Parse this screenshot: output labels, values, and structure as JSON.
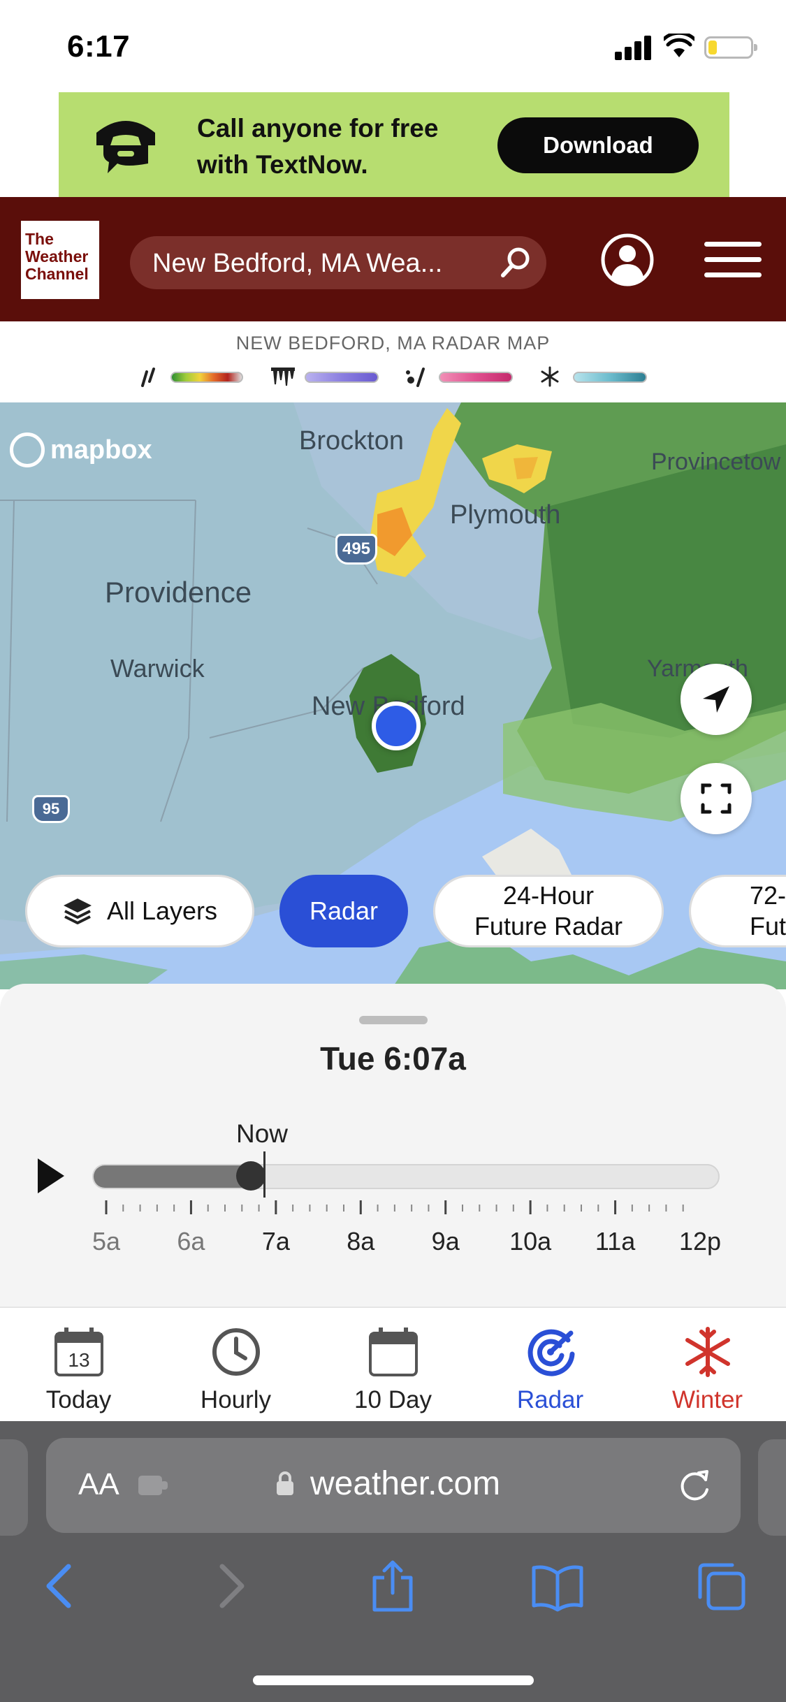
{
  "status_bar": {
    "time": "6:17"
  },
  "ad": {
    "line1": "Call anyone for free",
    "line2": "with TextNow.",
    "cta": "Download",
    "bg_color": "#b7dd70"
  },
  "header": {
    "logo_line1": "The",
    "logo_line2": "Weather",
    "logo_line3": "Channel",
    "search_value": "New Bedford, MA Wea...",
    "brand_color": "#5a0e0a"
  },
  "legend": {
    "title": "NEW BEDFORD, MA RADAR MAP",
    "items": [
      {
        "icon": "rain-icon",
        "label": "rain"
      },
      {
        "icon": "ice-icon",
        "label": "ice"
      },
      {
        "icon": "mix-icon",
        "label": "mix"
      },
      {
        "icon": "snow-icon",
        "label": "snow"
      }
    ]
  },
  "map": {
    "attribution": "mapbox",
    "labels": {
      "brockton": "Brockton",
      "provincetown": "Provincetow",
      "plymouth": "Plymouth",
      "providence": "Providence",
      "warwick": "Warwick",
      "yarmouth": "Yarmouth",
      "new_bedford": "New Bedford",
      "i495": "495",
      "i95": "95"
    },
    "chips": {
      "all_layers": "All Layers",
      "radar": "Radar",
      "future24_line1": "24-Hour",
      "future24_line2": "Future Radar",
      "future72_line1": "72-",
      "future72_line2": "Futur"
    }
  },
  "timeline": {
    "current_time": "Tue 6:07a",
    "now_label": "Now",
    "progress": 0.25,
    "ticks": [
      "5a",
      "6a",
      "7a",
      "8a",
      "9a",
      "10a",
      "11a",
      "12p"
    ],
    "past_ticks": [
      "5a",
      "6a"
    ]
  },
  "bottom_nav": {
    "today": "Today",
    "today_date": "13",
    "hourly": "Hourly",
    "tenday": "10 Day",
    "radar": "Radar",
    "winter": "Winter",
    "active_color": "#2a4fd6",
    "winter_color": "#d0342c"
  },
  "safari": {
    "aa_label": "AA",
    "url": "weather.com"
  }
}
